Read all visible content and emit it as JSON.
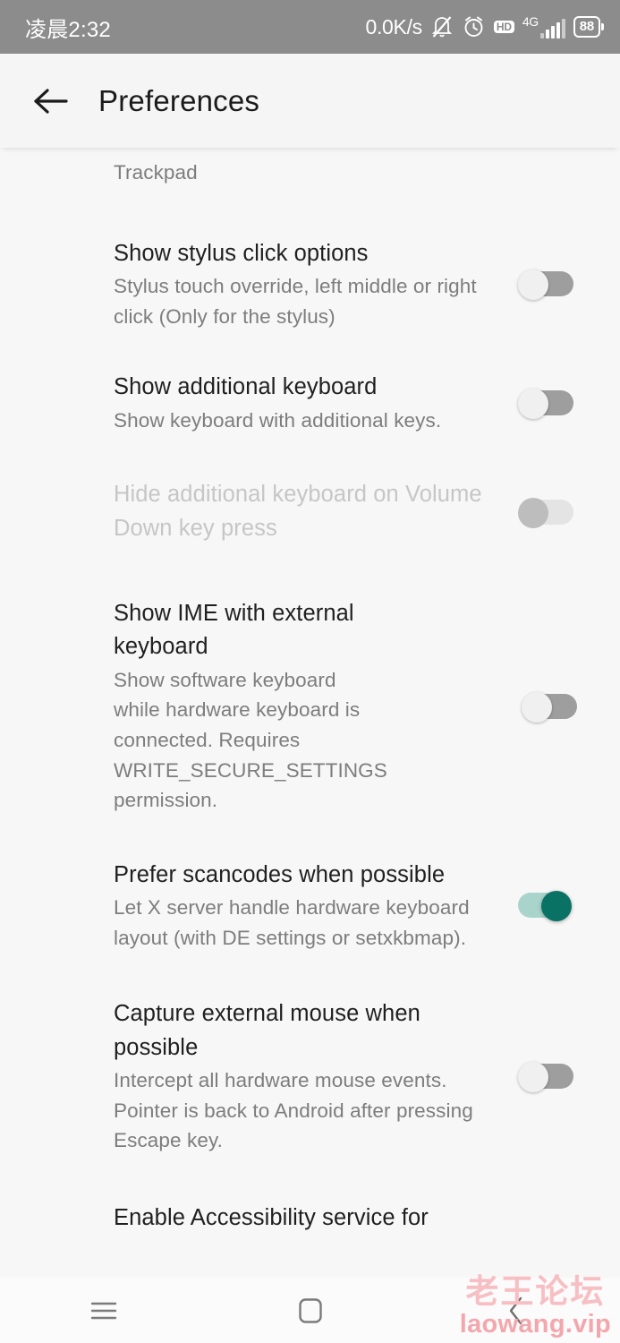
{
  "statusbar": {
    "time": "凌晨2:32",
    "net_speed": "0.0K/s",
    "mute_icon": "bell-muted-icon",
    "alarm_icon": "alarm-clock-icon",
    "hd_label": "HD",
    "network_type": "4G",
    "signal_icon": "signal-bars-icon",
    "battery_level": "88",
    "bg_color": "#8c8c8c"
  },
  "appbar": {
    "back_icon": "back-arrow-icon",
    "title": "Preferences"
  },
  "settings": {
    "partial_top": {
      "subtitle": "Trackpad"
    },
    "items": [
      {
        "title": "Show stylus click options",
        "subtitle": "Stylus touch override, left middle or right click (Only for the stylus)",
        "toggle_state": "off",
        "disabled": false
      },
      {
        "title": "Show additional keyboard",
        "subtitle": "Show keyboard with additional keys.",
        "toggle_state": "off",
        "disabled": false
      },
      {
        "title": "Hide additional keyboard on Volume Down key press",
        "subtitle": "",
        "toggle_state": "off",
        "disabled": true
      },
      {
        "title": "Show IME with external keyboard",
        "subtitle": "Show software keyboard while hardware keyboard is connected. Requires WRITE_SECURE_SETTINGS permission.",
        "toggle_state": "off",
        "disabled": false
      },
      {
        "title": "Prefer scancodes when possible",
        "subtitle": "Let X server handle hardware keyboard layout (with DE settings or setxkbmap).",
        "toggle_state": "on",
        "disabled": false
      },
      {
        "title": "Capture external mouse when possible",
        "subtitle": "Intercept all hardware mouse events. Pointer is back to Android after pressing Escape key.",
        "toggle_state": "off",
        "disabled": false
      }
    ],
    "partial_bottom": {
      "title": "Enable Accessibility service for"
    },
    "accent_on_color": "#0a7264",
    "accent_on_track_color": "#a9d4cc"
  },
  "navbar": {
    "recents_icon": "hamburger-menu-icon",
    "home_icon": "home-square-icon",
    "back_icon": "back-chevron-icon"
  },
  "watermark": {
    "cn": "老王论坛",
    "en": "laowang.vip",
    "color": "#f7bfc3"
  }
}
